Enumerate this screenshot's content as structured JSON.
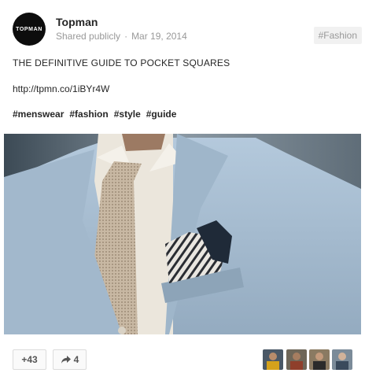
{
  "post": {
    "author": "Topman",
    "avatar_text": "TOPMAN",
    "visibility": "Shared publicly",
    "separator": "·",
    "date": "Mar 19, 2014",
    "category_tag": "#Fashion",
    "title": "THE DEFINITIVE GUIDE TO POCKET SQUARES",
    "link": "http://tpmn.co/1iBYr4W",
    "hashtags": [
      "#menswear",
      "#fashion",
      "#style",
      "#guide"
    ]
  },
  "actions": {
    "plus_count": "+43",
    "share_count": "4",
    "share_icon": "share-arrow-icon"
  },
  "colors": {
    "jacket": "#a9bfd3",
    "shirt": "#ece7de",
    "tie": "#c9b9a5",
    "avatar_bg": "#0d0d0d"
  }
}
